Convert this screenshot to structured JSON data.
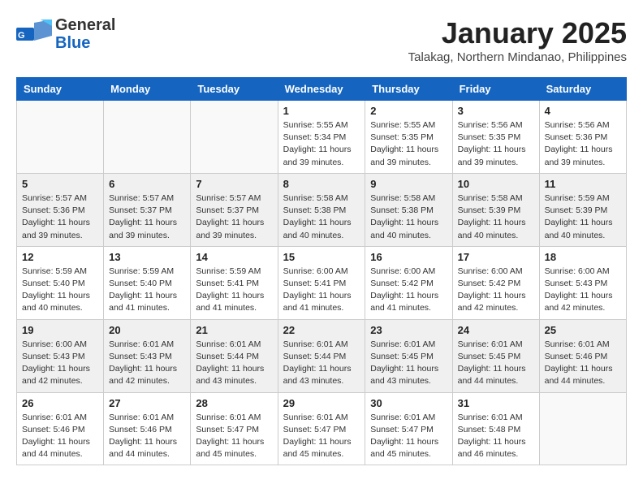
{
  "header": {
    "logo_line1": "General",
    "logo_line2": "Blue",
    "month": "January 2025",
    "location": "Talakag, Northern Mindanao, Philippines"
  },
  "days_of_week": [
    "Sunday",
    "Monday",
    "Tuesday",
    "Wednesday",
    "Thursday",
    "Friday",
    "Saturday"
  ],
  "weeks": [
    [
      {
        "day": "",
        "info": ""
      },
      {
        "day": "",
        "info": ""
      },
      {
        "day": "",
        "info": ""
      },
      {
        "day": "1",
        "info": "Sunrise: 5:55 AM\nSunset: 5:34 PM\nDaylight: 11 hours\nand 39 minutes."
      },
      {
        "day": "2",
        "info": "Sunrise: 5:55 AM\nSunset: 5:35 PM\nDaylight: 11 hours\nand 39 minutes."
      },
      {
        "day": "3",
        "info": "Sunrise: 5:56 AM\nSunset: 5:35 PM\nDaylight: 11 hours\nand 39 minutes."
      },
      {
        "day": "4",
        "info": "Sunrise: 5:56 AM\nSunset: 5:36 PM\nDaylight: 11 hours\nand 39 minutes."
      }
    ],
    [
      {
        "day": "5",
        "info": "Sunrise: 5:57 AM\nSunset: 5:36 PM\nDaylight: 11 hours\nand 39 minutes."
      },
      {
        "day": "6",
        "info": "Sunrise: 5:57 AM\nSunset: 5:37 PM\nDaylight: 11 hours\nand 39 minutes."
      },
      {
        "day": "7",
        "info": "Sunrise: 5:57 AM\nSunset: 5:37 PM\nDaylight: 11 hours\nand 39 minutes."
      },
      {
        "day": "8",
        "info": "Sunrise: 5:58 AM\nSunset: 5:38 PM\nDaylight: 11 hours\nand 40 minutes."
      },
      {
        "day": "9",
        "info": "Sunrise: 5:58 AM\nSunset: 5:38 PM\nDaylight: 11 hours\nand 40 minutes."
      },
      {
        "day": "10",
        "info": "Sunrise: 5:58 AM\nSunset: 5:39 PM\nDaylight: 11 hours\nand 40 minutes."
      },
      {
        "day": "11",
        "info": "Sunrise: 5:59 AM\nSunset: 5:39 PM\nDaylight: 11 hours\nand 40 minutes."
      }
    ],
    [
      {
        "day": "12",
        "info": "Sunrise: 5:59 AM\nSunset: 5:40 PM\nDaylight: 11 hours\nand 40 minutes."
      },
      {
        "day": "13",
        "info": "Sunrise: 5:59 AM\nSunset: 5:40 PM\nDaylight: 11 hours\nand 41 minutes."
      },
      {
        "day": "14",
        "info": "Sunrise: 5:59 AM\nSunset: 5:41 PM\nDaylight: 11 hours\nand 41 minutes."
      },
      {
        "day": "15",
        "info": "Sunrise: 6:00 AM\nSunset: 5:41 PM\nDaylight: 11 hours\nand 41 minutes."
      },
      {
        "day": "16",
        "info": "Sunrise: 6:00 AM\nSunset: 5:42 PM\nDaylight: 11 hours\nand 41 minutes."
      },
      {
        "day": "17",
        "info": "Sunrise: 6:00 AM\nSunset: 5:42 PM\nDaylight: 11 hours\nand 42 minutes."
      },
      {
        "day": "18",
        "info": "Sunrise: 6:00 AM\nSunset: 5:43 PM\nDaylight: 11 hours\nand 42 minutes."
      }
    ],
    [
      {
        "day": "19",
        "info": "Sunrise: 6:00 AM\nSunset: 5:43 PM\nDaylight: 11 hours\nand 42 minutes."
      },
      {
        "day": "20",
        "info": "Sunrise: 6:01 AM\nSunset: 5:43 PM\nDaylight: 11 hours\nand 42 minutes."
      },
      {
        "day": "21",
        "info": "Sunrise: 6:01 AM\nSunset: 5:44 PM\nDaylight: 11 hours\nand 43 minutes."
      },
      {
        "day": "22",
        "info": "Sunrise: 6:01 AM\nSunset: 5:44 PM\nDaylight: 11 hours\nand 43 minutes."
      },
      {
        "day": "23",
        "info": "Sunrise: 6:01 AM\nSunset: 5:45 PM\nDaylight: 11 hours\nand 43 minutes."
      },
      {
        "day": "24",
        "info": "Sunrise: 6:01 AM\nSunset: 5:45 PM\nDaylight: 11 hours\nand 44 minutes."
      },
      {
        "day": "25",
        "info": "Sunrise: 6:01 AM\nSunset: 5:46 PM\nDaylight: 11 hours\nand 44 minutes."
      }
    ],
    [
      {
        "day": "26",
        "info": "Sunrise: 6:01 AM\nSunset: 5:46 PM\nDaylight: 11 hours\nand 44 minutes."
      },
      {
        "day": "27",
        "info": "Sunrise: 6:01 AM\nSunset: 5:46 PM\nDaylight: 11 hours\nand 44 minutes."
      },
      {
        "day": "28",
        "info": "Sunrise: 6:01 AM\nSunset: 5:47 PM\nDaylight: 11 hours\nand 45 minutes."
      },
      {
        "day": "29",
        "info": "Sunrise: 6:01 AM\nSunset: 5:47 PM\nDaylight: 11 hours\nand 45 minutes."
      },
      {
        "day": "30",
        "info": "Sunrise: 6:01 AM\nSunset: 5:47 PM\nDaylight: 11 hours\nand 45 minutes."
      },
      {
        "day": "31",
        "info": "Sunrise: 6:01 AM\nSunset: 5:48 PM\nDaylight: 11 hours\nand 46 minutes."
      },
      {
        "day": "",
        "info": ""
      }
    ]
  ],
  "shaded_weeks": [
    1,
    3
  ]
}
